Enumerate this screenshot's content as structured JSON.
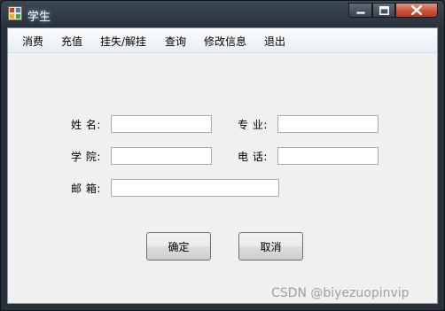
{
  "window": {
    "title": "学生"
  },
  "menu": {
    "items": [
      {
        "id": "consume",
        "label": "消费"
      },
      {
        "id": "recharge",
        "label": "充值"
      },
      {
        "id": "loss",
        "label": "挂失/解挂"
      },
      {
        "id": "query",
        "label": "查询"
      },
      {
        "id": "modify",
        "label": "修改信息"
      },
      {
        "id": "exit",
        "label": "退出"
      }
    ]
  },
  "form": {
    "name_label": "姓 名:",
    "major_label": "专 业:",
    "college_label": "学 院:",
    "phone_label": "电 话:",
    "email_label": "邮 箱:",
    "name_value": "",
    "major_value": "",
    "college_value": "",
    "phone_value": "",
    "email_value": ""
  },
  "buttons": {
    "confirm": "确定",
    "cancel": "取消"
  },
  "watermark": "CSDN @biyezuopinvip",
  "colors": {
    "titlebar": "#27313b",
    "close_button": "#c7503a",
    "client_bg": "#f0f0f0"
  }
}
